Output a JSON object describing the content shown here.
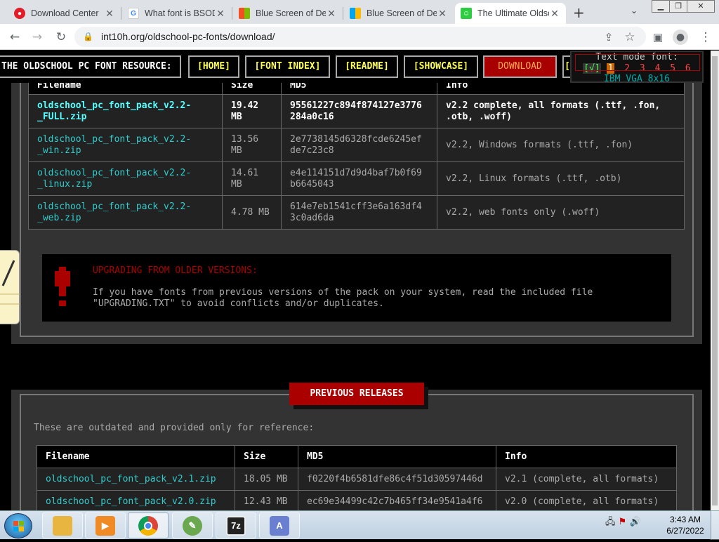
{
  "browser": {
    "tabs": [
      {
        "title": "Download Center",
        "favicon_color": "#e11d2a",
        "active": false
      },
      {
        "title": "What font is BSOD",
        "favicon_color": "#4285f4",
        "active": false
      },
      {
        "title": "Blue Screen of Death",
        "favicon_color": "#0078d4",
        "active": false
      },
      {
        "title": "Blue Screen of Death",
        "favicon_color": "#0078d4",
        "active": false
      },
      {
        "title": "The Ultimate Oldschool PC Font Pack",
        "favicon_color": "#2ecc40",
        "active": true
      }
    ],
    "new_tab_label": "+",
    "url": "int10h.org/oldschool-pc-fonts/download/"
  },
  "site": {
    "title": "THE OLDSCHOOL PC FONT RESOURCE:",
    "nav": [
      "[HOME]",
      "[FONT INDEX]",
      "[README]",
      "[SHOWCASE]",
      "DOWNLOAD",
      "["
    ],
    "font_selector": {
      "label": "Text mode font:",
      "check": "[√]",
      "options": [
        "1",
        "2",
        "3",
        "4",
        "5",
        "6"
      ],
      "selected_name": "IBM VGA 8x16"
    }
  },
  "current_table": {
    "headers": [
      "Filename",
      "Size",
      "MD5",
      "Info"
    ],
    "rows": [
      {
        "file": [
          "oldschool_pc_font_pack_v2.2-",
          "_FULL.zip"
        ],
        "size": [
          "19.42",
          "MB"
        ],
        "md5": [
          "95561227c894f874127e3776",
          "284a0c16"
        ],
        "info": [
          "v2.2 complete, all formats (.ttf, .fon,",
          ".otb, .woff)"
        ]
      },
      {
        "file": [
          "oldschool_pc_font_pack_v2.2-",
          "_win.zip"
        ],
        "size": [
          "13.56",
          "MB"
        ],
        "md5": [
          "2e7738145d6328fcde6245ef",
          "de7c23c8"
        ],
        "info": [
          "v2.2, Windows formats (.ttf, .fon)",
          ""
        ]
      },
      {
        "file": [
          "oldschool_pc_font_pack_v2.2-",
          "_linux.zip"
        ],
        "size": [
          "14.61",
          "MB"
        ],
        "md5": [
          "e4e114151d7d9d4baf7b0f69",
          "b6645043"
        ],
        "info": [
          "v2.2, Linux formats (.ttf, .otb)",
          ""
        ]
      },
      {
        "file": [
          "oldschool_pc_font_pack_v2.2-",
          "_web.zip"
        ],
        "size": [
          "4.78 MB",
          ""
        ],
        "md5": [
          "614e7eb1541cff3e6a163df4",
          "3c0ad6da"
        ],
        "info": [
          "v2.2, web fonts only (.woff)",
          ""
        ]
      }
    ]
  },
  "upgrade_notice": {
    "heading": "UPGRADING FROM OLDER VERSIONS:",
    "body_line1": "If you have fonts from previous versions of the pack on your system, read the included file",
    "body_line2": "\"UPGRADING.TXT\" to avoid conflicts and/or duplicates."
  },
  "previous": {
    "button": "PREVIOUS RELEASES",
    "note": "These are outdated and provided only for reference:",
    "headers": [
      "Filename",
      "Size",
      "MD5",
      "Info"
    ],
    "rows": [
      {
        "file": "oldschool_pc_font_pack_v2.1.zip",
        "size": "18.05 MB",
        "md5": "f0220f4b6581dfe86c4f51d30597446d",
        "info": "v2.1 (complete, all formats)"
      },
      {
        "file": "oldschool_pc_font_pack_v2.0.zip",
        "size": "12.43 MB",
        "md5": "ec69e34499c42c7b465ff34e9541a4f6",
        "info": "v2.0 (complete, all formats)"
      }
    ]
  },
  "taskbar": {
    "apps": [
      {
        "name": "explorer",
        "label": "",
        "color": "#e8b640"
      },
      {
        "name": "media-player",
        "label": "",
        "color": "#f08a24"
      },
      {
        "name": "chrome",
        "label": "",
        "color": "#db4437"
      },
      {
        "name": "paint",
        "label": "",
        "color": "#6aa84f"
      },
      {
        "name": "7zip",
        "label": "7z",
        "color": "#222222"
      },
      {
        "name": "font-app",
        "label": "A",
        "color": "#6a7fd0"
      }
    ],
    "time": "3:43 AM",
    "date": "6/27/2022"
  }
}
